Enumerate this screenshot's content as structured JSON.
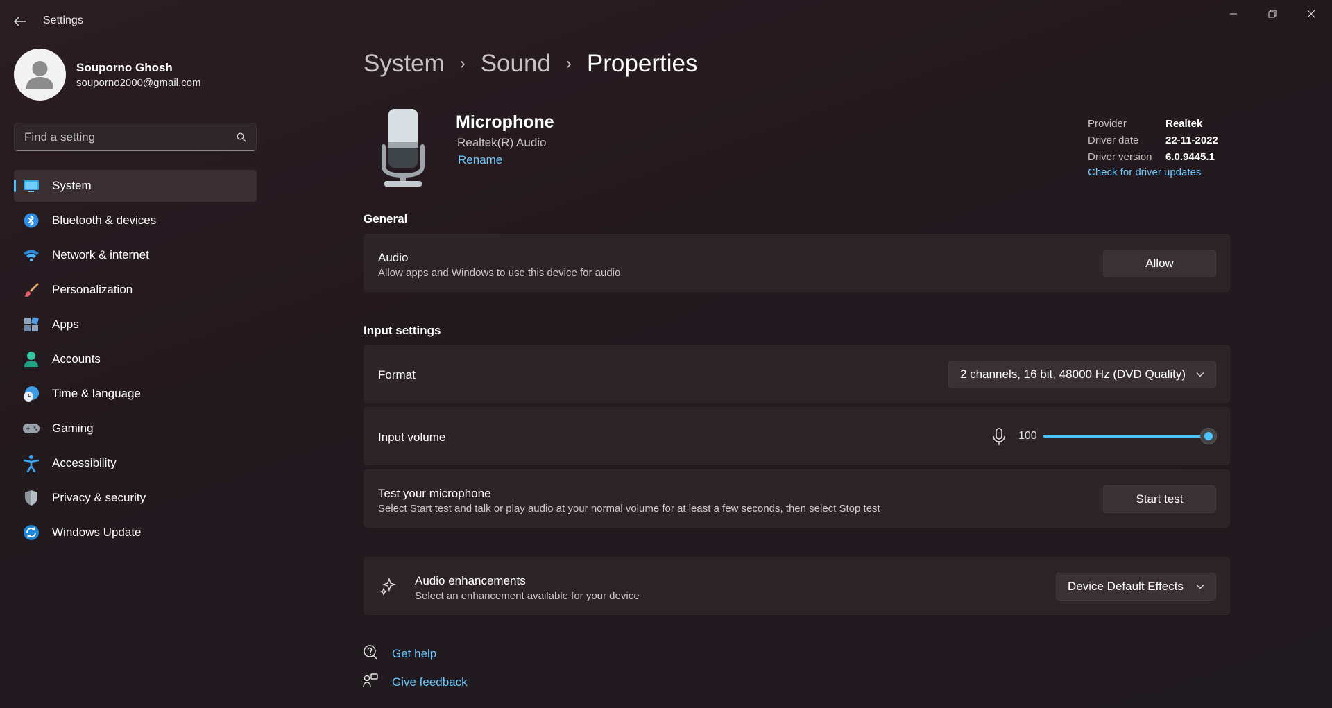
{
  "window": {
    "title": "Settings",
    "controls": {
      "minimize_icon": "minimize-icon",
      "maximize_icon": "restore-icon",
      "close_icon": "close-icon"
    }
  },
  "profile": {
    "name": "Souporno Ghosh",
    "email": "souporno2000@gmail.com"
  },
  "search": {
    "placeholder": "Find a setting",
    "value": ""
  },
  "sidebar": {
    "items": [
      {
        "label": "System",
        "icon": "system-icon",
        "active": true
      },
      {
        "label": "Bluetooth & devices",
        "icon": "bluetooth-icon"
      },
      {
        "label": "Network & internet",
        "icon": "wifi-icon"
      },
      {
        "label": "Personalization",
        "icon": "brush-icon"
      },
      {
        "label": "Apps",
        "icon": "apps-icon"
      },
      {
        "label": "Accounts",
        "icon": "accounts-icon"
      },
      {
        "label": "Time & language",
        "icon": "clock-globe-icon"
      },
      {
        "label": "Gaming",
        "icon": "gamepad-icon"
      },
      {
        "label": "Accessibility",
        "icon": "accessibility-icon"
      },
      {
        "label": "Privacy & security",
        "icon": "shield-icon"
      },
      {
        "label": "Windows Update",
        "icon": "update-icon"
      }
    ]
  },
  "breadcrumb": {
    "items": [
      "System",
      "Sound",
      "Properties"
    ],
    "separator": "›"
  },
  "device": {
    "name": "Microphone",
    "subtitle": "Realtek(R) Audio",
    "rename_label": "Rename",
    "info": [
      {
        "key": "Provider",
        "value": "Realtek"
      },
      {
        "key": "Driver date",
        "value": "22-11-2022"
      },
      {
        "key": "Driver version",
        "value": "6.0.9445.1"
      }
    ],
    "driver_link": "Check for driver updates"
  },
  "general": {
    "title": "General",
    "audio": {
      "title": "Audio",
      "desc": "Allow apps and Windows to use this device for audio",
      "button": "Allow"
    }
  },
  "input_settings": {
    "title": "Input settings",
    "format": {
      "label": "Format",
      "value": "2 channels, 16 bit, 48000 Hz (DVD Quality)"
    },
    "volume": {
      "label": "Input volume",
      "value": "100",
      "level": 1.0
    },
    "test": {
      "title": "Test your microphone",
      "desc": "Select Start test and talk or play audio at your normal volume for at least a few seconds, then select Stop test",
      "button": "Start test"
    }
  },
  "enhancements": {
    "title": "Audio enhancements",
    "desc": "Select an enhancement available for your device",
    "value": "Device Default Effects"
  },
  "footer": {
    "help": "Get help",
    "feedback": "Give feedback"
  },
  "colors": {
    "accent": "#4cc2ff",
    "link": "#6cc8ff",
    "card": "#2d2427"
  }
}
